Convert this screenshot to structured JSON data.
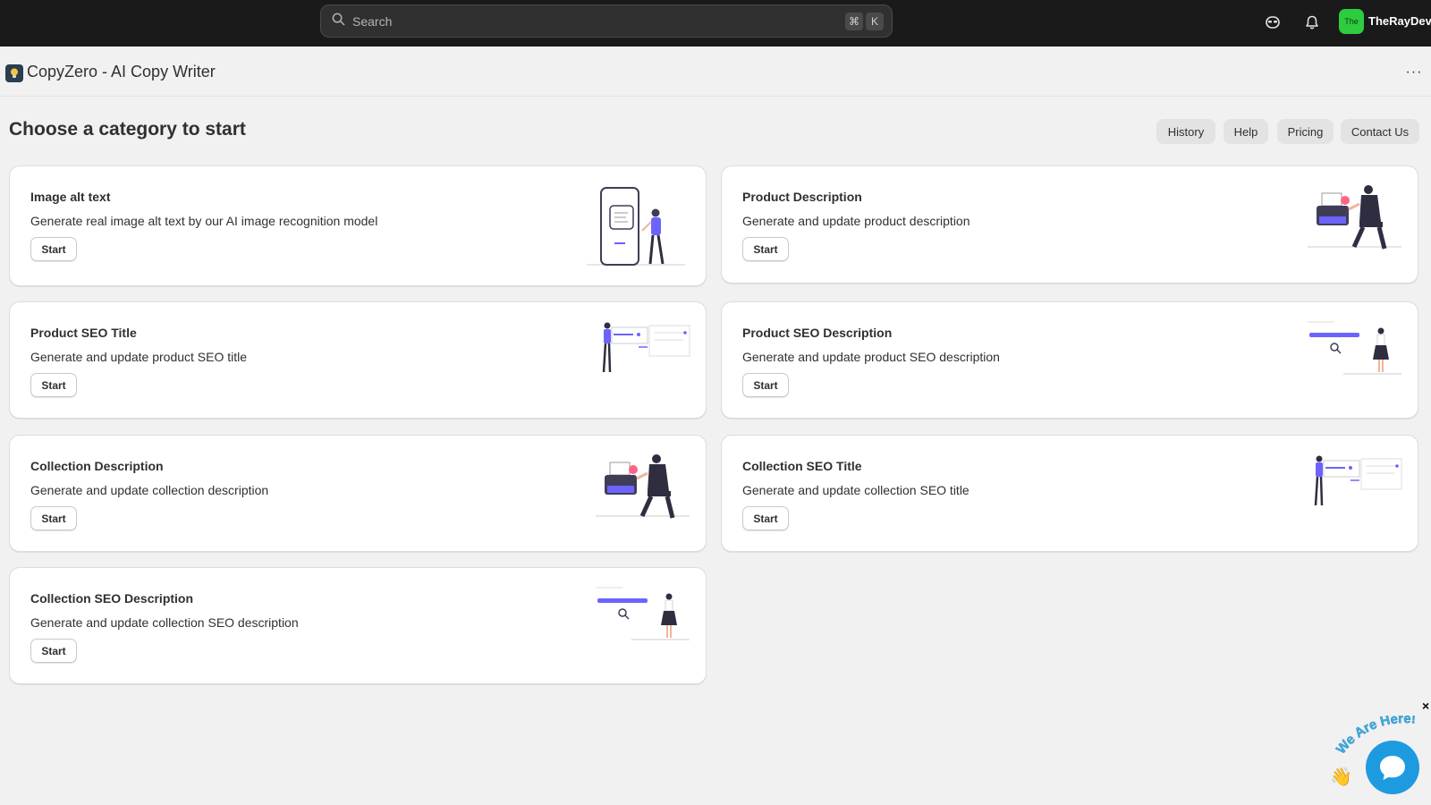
{
  "topbar": {
    "search_placeholder": "Search",
    "shortcut_keys": [
      "⌘",
      "K"
    ],
    "icons": [
      "search-icon",
      "mask-icon",
      "bell-icon"
    ],
    "store_avatar": "The",
    "store_name": "TheRayDev"
  },
  "app": {
    "title": "CopyZero - AI Copy Writer",
    "more_label": "···"
  },
  "page": {
    "title": "Choose a category to start",
    "actions": [
      "History",
      "Help",
      "Pricing",
      "Contact Us"
    ]
  },
  "cards": [
    {
      "title": "Image alt text",
      "description": "Generate real image alt text by our AI image recognition model",
      "button": "Start",
      "illustration": "phone-person-illustration"
    },
    {
      "title": "Product Description",
      "description": "Generate and update product description",
      "button": "Start",
      "illustration": "typewriter-person-illustration"
    },
    {
      "title": "Product SEO Title",
      "description": "Generate and update product SEO title",
      "button": "Start",
      "illustration": "person-charts-illustration"
    },
    {
      "title": "Product SEO Description",
      "description": "Generate and update product SEO description",
      "button": "Start",
      "illustration": "search-woman-illustration"
    },
    {
      "title": "Collection Description",
      "description": "Generate and update collection description",
      "button": "Start",
      "illustration": "typewriter-person-illustration"
    },
    {
      "title": "Collection SEO Title",
      "description": "Generate and update collection SEO title",
      "button": "Start",
      "illustration": "person-charts-illustration"
    },
    {
      "title": "Collection SEO Description",
      "description": "Generate and update collection SEO description",
      "button": "Start",
      "illustration": "search-woman-illustration"
    }
  ],
  "chat_widget": {
    "banner": "We Are Here!",
    "close": "×"
  },
  "colors": {
    "accent": "#6c63ff",
    "topbar": "#1a1a1a",
    "chat": "#1e9be0",
    "avatar": "#2ecc40"
  }
}
